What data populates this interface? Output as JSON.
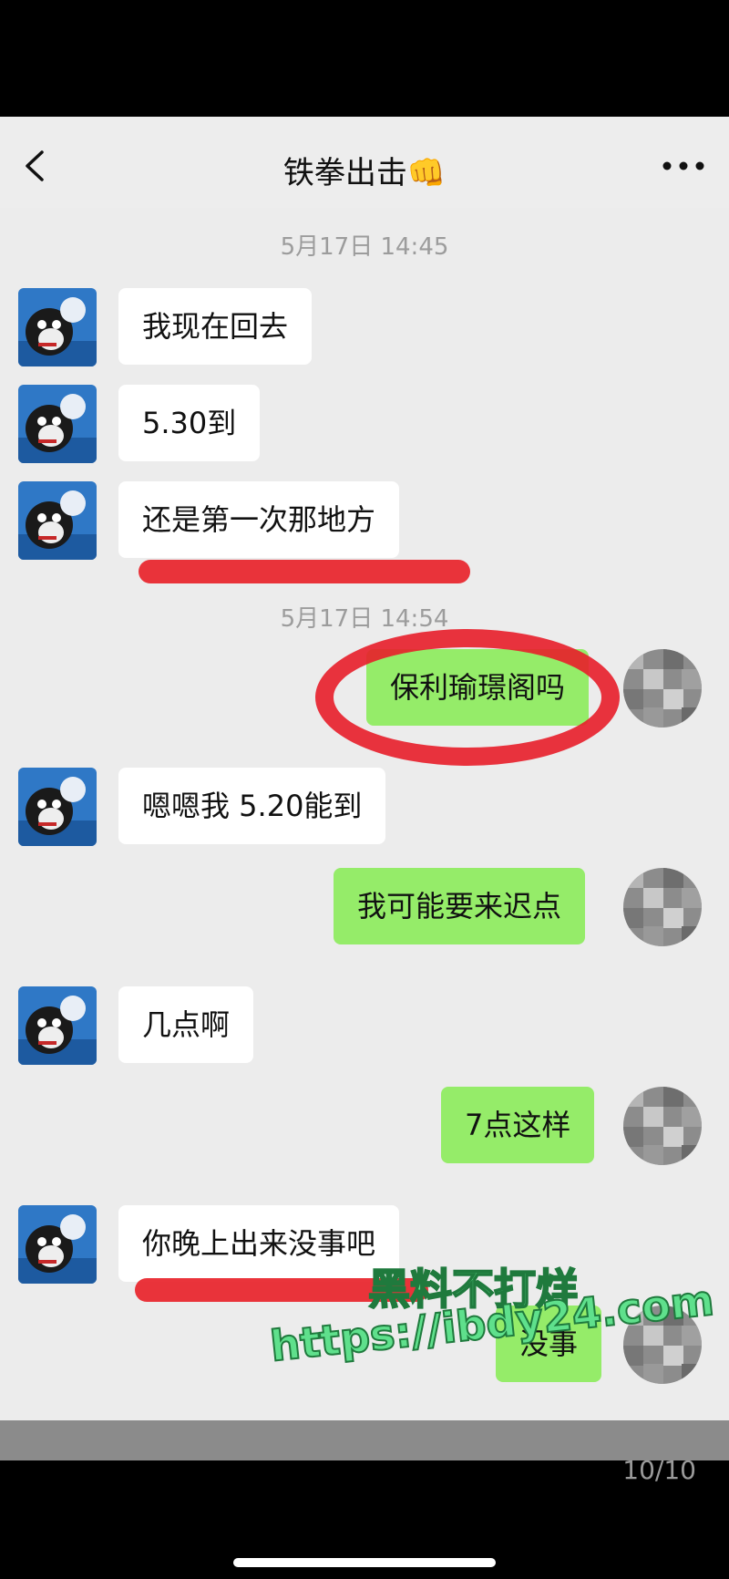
{
  "header": {
    "title": "铁拳出击👊"
  },
  "timestamps": {
    "t1": "5月17日 14:45",
    "t2": "5月17日 14:54"
  },
  "messages": [
    {
      "text": "我现在回去"
    },
    {
      "text": "5.30到"
    },
    {
      "text": "还是第一次那地方"
    },
    {
      "text": "保利瑜璟阁吗"
    },
    {
      "text": "嗯嗯我 5.20能到"
    },
    {
      "text": "我可能要来迟点"
    },
    {
      "text": "几点啊"
    },
    {
      "text": "7点这样"
    },
    {
      "text": "你晚上出来没事吧"
    },
    {
      "text": "没事"
    }
  ],
  "pager": {
    "label": "10/10"
  },
  "watermark": {
    "line1": "黑料不打烊",
    "line2": "https://ibdy24.com"
  },
  "colors": {
    "outgoing": "#95ec69",
    "incoming": "#ffffff",
    "annotation": "#e8232a"
  }
}
